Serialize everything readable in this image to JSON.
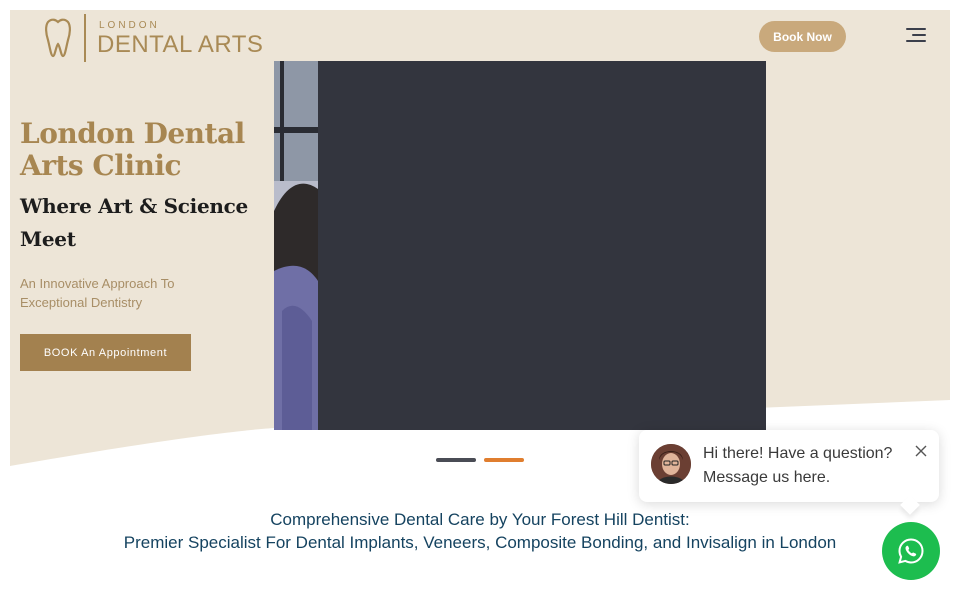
{
  "colors": {
    "hero_bg": "#ede5d7",
    "gold": "#a78651",
    "book_now_bg": "#c9a97c",
    "cta_bg": "#a3814f",
    "video_bg": "#33353e",
    "dot_inactive": "#4a4c55",
    "dot_active": "#e07e2f",
    "headline_blue": "#154360",
    "whatsapp_green": "#1dbd4f"
  },
  "header": {
    "logo_small": "LONDON",
    "logo_big": "DENTAL ARTS",
    "book_now_label": "Book Now",
    "menu_icon": "hamburger-menu-icon"
  },
  "hero": {
    "title": "London Dental Arts Clinic",
    "subtitle": "Where Art & Science Meet",
    "description": "An Innovative Approach To Exceptional Dentistry",
    "cta_label": "BOOK An Appointment"
  },
  "slider": {
    "slide_count": 2,
    "active_index": 1
  },
  "intro": {
    "line1": "Comprehensive Dental Care by Your Forest Hill Dentist:",
    "line2": "Premier Specialist For Dental Implants, Veneers, Composite Bonding, and Invisalign in London"
  },
  "chat": {
    "line1": "Hi there! Have a question?",
    "line2": "Message us here.",
    "close_icon": "close-icon",
    "whatsapp_icon": "whatsapp-icon"
  }
}
